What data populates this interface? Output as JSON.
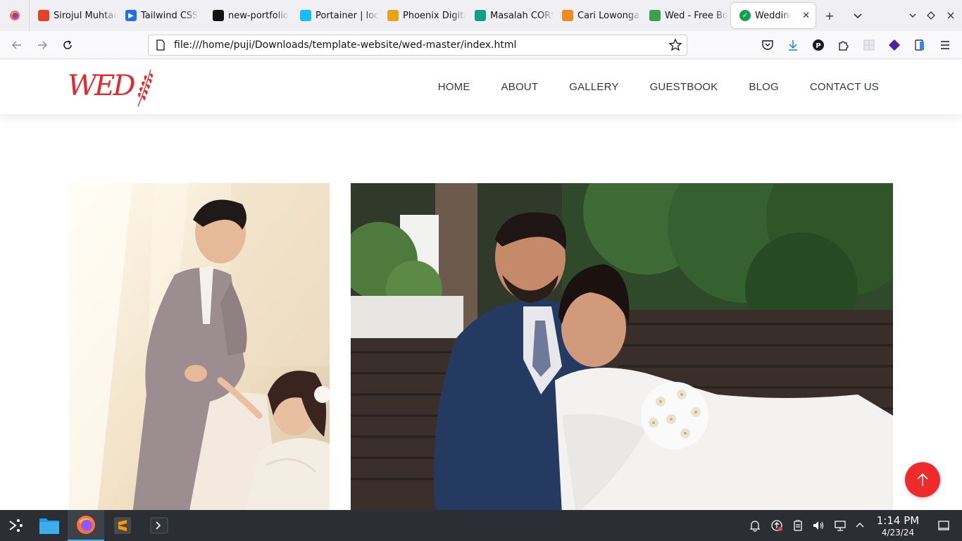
{
  "browser": {
    "tabs": [
      {
        "title": "Sirojul Muhtadi",
        "color": "#e24329",
        "glyph": ""
      },
      {
        "title": "Tailwind CSS",
        "color": "#1f6feb",
        "glyph": "▶"
      },
      {
        "title": "new-portfolio",
        "color": "#111111",
        "glyph": ""
      },
      {
        "title": "Portainer | localhost",
        "color": "#13bef9",
        "glyph": ""
      },
      {
        "title": "Phoenix Digital",
        "color": "#e8a416",
        "glyph": ""
      },
      {
        "title": "Masalah CORS",
        "color": "#10a37f",
        "glyph": ""
      },
      {
        "title": "Cari Lowongan",
        "color": "#f08a24",
        "glyph": ""
      },
      {
        "title": "Wed - Free Bootstrap",
        "color": "#3aa04a",
        "glyph": ""
      }
    ],
    "active_tab": {
      "title": "Wedding |",
      "close": "✕"
    },
    "new_tab": "+",
    "url": "file:///home/puji/Downloads/template-website/wed-master/index.html"
  },
  "site": {
    "logo": "WED",
    "nav": [
      "HOME",
      "ABOUT",
      "GALLERY",
      "GUESTBOOK",
      "BLOG",
      "CONTACT US"
    ],
    "accent": "#e8262d"
  },
  "taskbar": {
    "time": "1:14 PM",
    "date": "4/23/24"
  }
}
